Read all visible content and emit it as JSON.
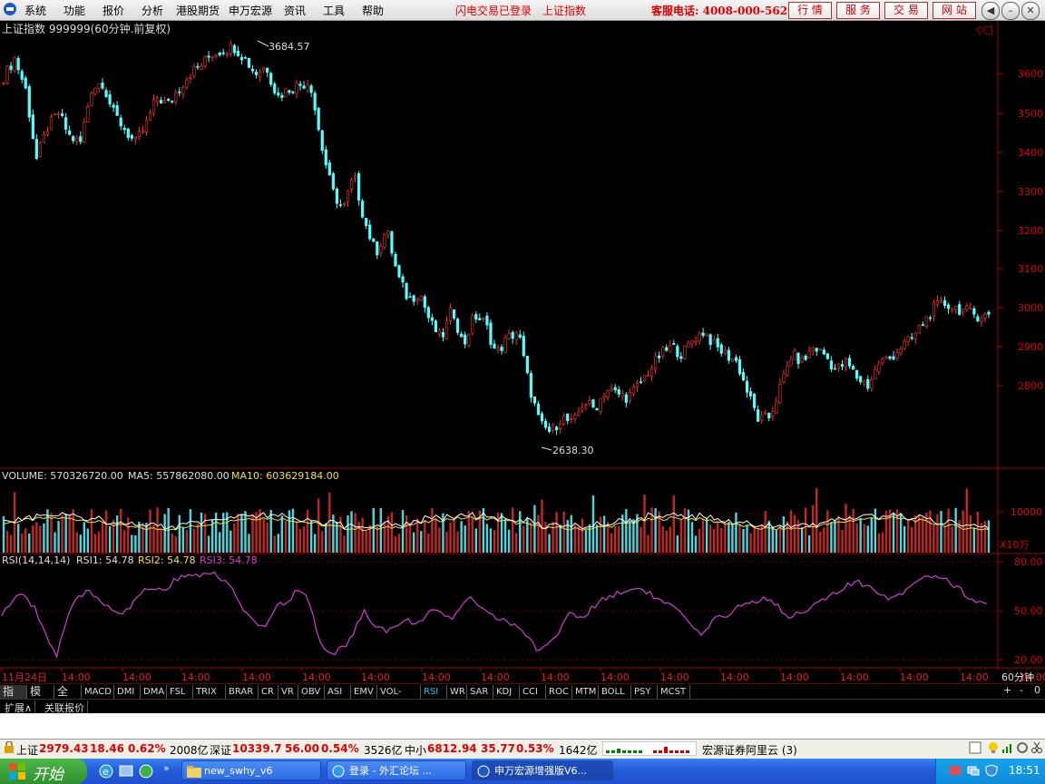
{
  "menubar": {
    "items": [
      "系统",
      "功能",
      "报价",
      "分析",
      "港股期货",
      "申万宏源",
      "资讯",
      "工具",
      "帮助"
    ],
    "login_status": "闪电交易已登录",
    "current_index": "上证指数",
    "hotline": "客服电话: 4008-000-562",
    "buttons": [
      "行 情",
      "服 务",
      "交 易",
      "网 站"
    ]
  },
  "price_panel": {
    "header": "上证指数 999999(60分钟.前复权)",
    "high_label": "3684.57",
    "low_label": "2638.30",
    "y_ticks": [
      "3600",
      "3500",
      "3400",
      "3300",
      "3200",
      "3100",
      "3000",
      "2900",
      "2800"
    ]
  },
  "volume_panel": {
    "label": "VOLUME: 570326720.00",
    "ma5": "MA5: 557862080.00",
    "ma10": "MA10: 603629184.00",
    "y_tick": "10000",
    "unit": "X10万"
  },
  "rsi_panel": {
    "label": "RSI(14,14,14)",
    "rsi1": "RSI1: 54.78",
    "rsi2": "RSI2: 54.78",
    "rsi3": "RSI3: 54.78",
    "y_ticks": [
      "80.00",
      "50.00",
      "20.00"
    ]
  },
  "time_axis": {
    "labels": [
      "11月24日",
      "14:00",
      "14:00",
      "14:00",
      "14:00",
      "14:00",
      "14:00",
      "14:00",
      "14:00",
      "14:00",
      "14:00",
      "14:00",
      "14:00",
      "14:00",
      "14:00",
      "14:00",
      "14:00",
      "14:00"
    ],
    "period": "60分钟"
  },
  "indicator_tabs": [
    "指标",
    "模板",
    "全部",
    "MACD",
    "DMI",
    "DMA",
    "FSL",
    "TRIX",
    "BRAR",
    "CR",
    "VR",
    "OBV",
    "ASI",
    "EMV",
    "VOL-TDX",
    "RSI",
    "WR",
    "SAR",
    "KDJ",
    "CCI",
    "ROC",
    "MTM",
    "BOLL",
    "PSY",
    "MCST"
  ],
  "tab_controls": [
    "+",
    "-",
    "0"
  ],
  "extra_tabs": [
    "扩展∧",
    "关联报价"
  ],
  "status_bar": {
    "sh_name": "上证",
    "sh_value": "2979.43",
    "sh_change": "18.46",
    "sh_pct": "0.62%",
    "sh_amount": "2008亿",
    "sz_name": "深证",
    "sz_value": "10339.7",
    "sz_change": "56.00",
    "sz_pct": "0.54%",
    "sz_amount": "3526亿",
    "sme_name": "中小",
    "sme_value": "6812.94",
    "sme_change": "35.77",
    "sme_pct": "0.53%",
    "sme_amount": "1642亿",
    "server": "宏源证券阿里云 (3)"
  },
  "taskbar": {
    "start": "开始",
    "tasks": [
      "new_swhy_v6",
      "登录 - 外汇论坛 ...",
      "申万宏源增强版V6..."
    ],
    "clock": "18:51"
  },
  "chart_data": {
    "type": "candlestick",
    "title": "上证指数 999999(60分钟.前复权)",
    "price_range": [
      2600,
      3700
    ],
    "series_high": 3684.57,
    "series_low": 2638.3,
    "close_path": [
      3590,
      3640,
      3560,
      3380,
      3460,
      3500,
      3440,
      3420,
      3560,
      3580,
      3500,
      3460,
      3420,
      3470,
      3540,
      3520,
      3560,
      3600,
      3620,
      3650,
      3660,
      3670,
      3640,
      3600,
      3620,
      3540,
      3560,
      3570,
      3580,
      3420,
      3300,
      3250,
      3340,
      3220,
      3140,
      3200,
      3080,
      3020,
      3040,
      2960,
      2920,
      3000,
      2900,
      2980,
      2960,
      2880,
      2920,
      2940,
      2800,
      2700,
      2680,
      2720,
      2700,
      2760,
      2740,
      2790,
      2780,
      2770,
      2800,
      2840,
      2880,
      2900,
      2880,
      2920,
      2940,
      2900,
      2880,
      2860,
      2780,
      2710,
      2720,
      2800,
      2880,
      2860,
      2900,
      2880,
      2840,
      2860,
      2820,
      2800,
      2860,
      2870,
      2900,
      2920,
      2960,
      3000,
      3010,
      3000,
      2990,
      2980,
      2979
    ],
    "rsi": [
      48,
      56,
      60,
      52,
      36,
      22,
      46,
      58,
      62,
      56,
      52,
      48,
      54,
      62,
      64,
      62,
      70,
      72,
      70,
      74,
      70,
      64,
      50,
      42,
      40,
      52,
      56,
      62,
      58,
      30,
      24,
      26,
      34,
      50,
      42,
      38,
      40,
      44,
      42,
      50,
      48,
      44,
      54,
      58,
      52,
      46,
      44,
      40,
      34,
      26,
      30,
      38,
      50,
      44,
      52,
      58,
      60,
      62,
      64,
      62,
      56,
      54,
      48,
      40,
      34,
      44,
      46,
      52,
      54,
      56,
      58,
      52,
      46,
      50,
      52,
      56,
      60,
      64,
      68,
      64,
      62,
      58,
      60,
      66,
      70,
      72,
      70,
      66,
      60,
      56,
      54
    ],
    "volume_ma_level": 10000
  }
}
